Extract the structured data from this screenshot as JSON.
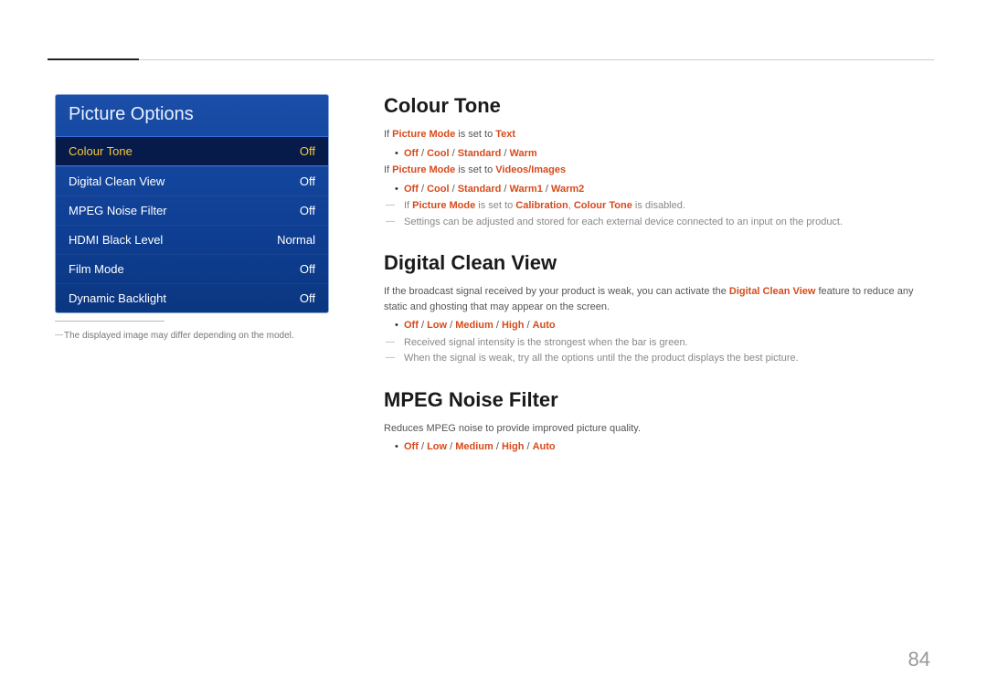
{
  "menu": {
    "title": "Picture Options",
    "items": [
      {
        "label": "Colour Tone",
        "value": "Off",
        "selected": true
      },
      {
        "label": "Digital Clean View",
        "value": "Off",
        "selected": false
      },
      {
        "label": "MPEG Noise Filter",
        "value": "Off",
        "selected": false
      },
      {
        "label": "HDMI Black Level",
        "value": "Normal",
        "selected": false
      },
      {
        "label": "Film Mode",
        "value": "Off",
        "selected": false
      },
      {
        "label": "Dynamic Backlight",
        "value": "Off",
        "selected": false
      }
    ],
    "disclaimer": "The displayed image may differ depending on the model."
  },
  "sections": {
    "colour_tone": {
      "heading": "Colour Tone",
      "line1_pre": "If ",
      "line1_accent": "Picture Mode",
      "line1_mid": " is set to ",
      "line1_accent2": "Text",
      "opts1": [
        "Off",
        "Cool",
        "Standard",
        "Warm"
      ],
      "line2_pre": "If ",
      "line2_accent": "Picture Mode",
      "line2_mid": " is set to ",
      "line2_accent2": "Videos/Images",
      "opts2": [
        "Off",
        "Cool",
        "Standard",
        "Warm1",
        "Warm2"
      ],
      "note1_pre": "If ",
      "note1_a": "Picture Mode",
      "note1_mid": " is set to ",
      "note1_b": "Calibration",
      "note1_sep": ", ",
      "note1_c": "Colour Tone",
      "note1_post": " is disabled.",
      "note2": "Settings can be adjusted and stored for each external device connected to an input on the product."
    },
    "dcv": {
      "heading": "Digital Clean View",
      "body_pre": "If the broadcast signal received by your product is weak, you can activate the ",
      "body_accent": "Digital Clean View",
      "body_post": " feature to reduce any static and ghosting that may appear on the screen.",
      "opts": [
        "Off",
        "Low",
        "Medium",
        "High",
        "Auto"
      ],
      "note1": "Received signal intensity is the strongest when the bar is green.",
      "note2": "When the signal is weak, try all the options until the the product displays the best picture."
    },
    "mpeg": {
      "heading": "MPEG Noise Filter",
      "body": "Reduces MPEG noise to provide improved picture quality.",
      "opts": [
        "Off",
        "Low",
        "Medium",
        "High",
        "Auto"
      ]
    }
  },
  "page_number": "84"
}
